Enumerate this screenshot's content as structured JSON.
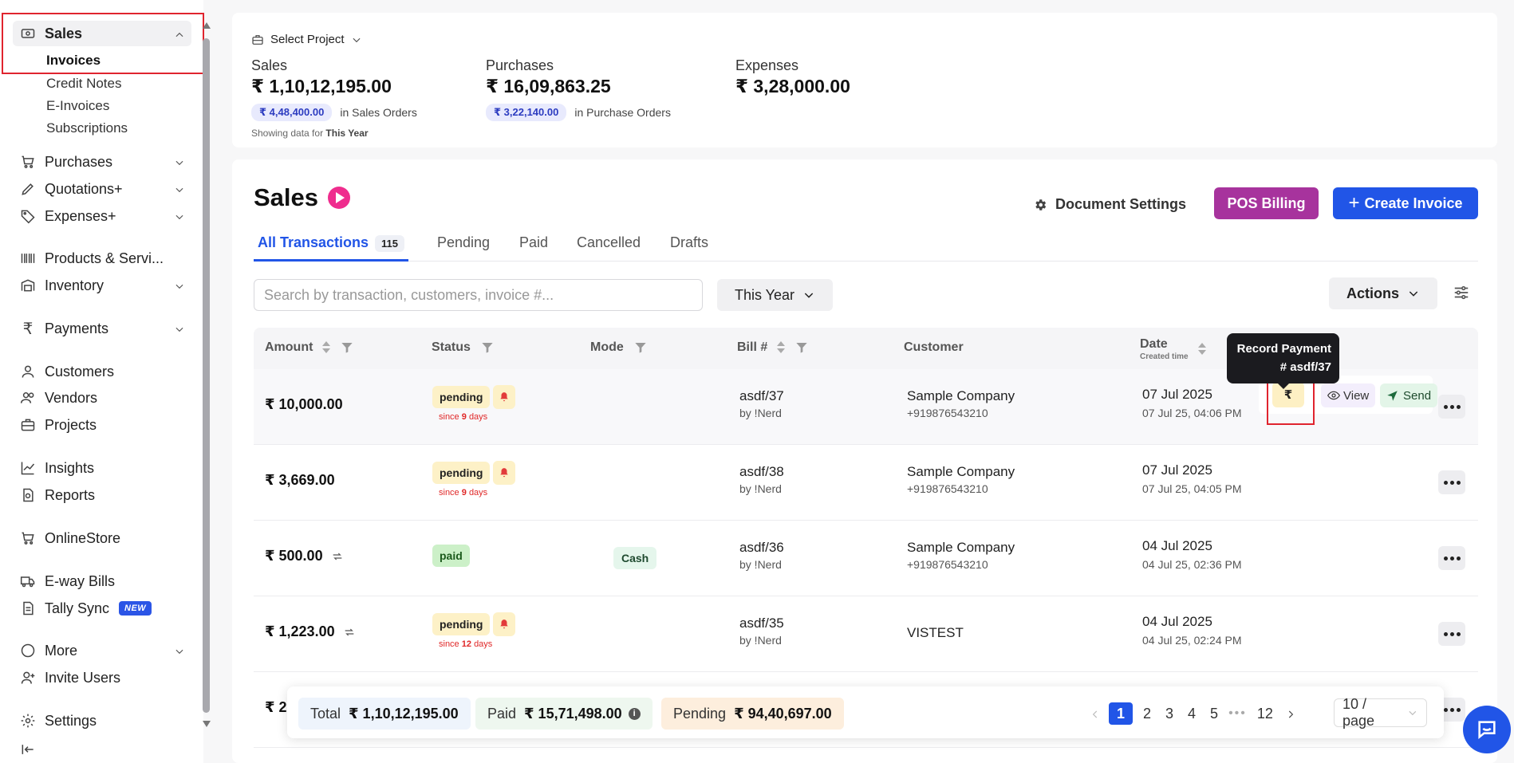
{
  "sidebar": {
    "sales": {
      "label": "Sales",
      "subs": [
        "Invoices",
        "Credit Notes",
        "E-Invoices",
        "Subscriptions"
      ]
    },
    "items": [
      {
        "label": "Purchases"
      },
      {
        "label": "Quotations+"
      },
      {
        "label": "Expenses+"
      },
      {
        "label": "Products & Servi..."
      },
      {
        "label": "Inventory"
      },
      {
        "label": "Payments"
      },
      {
        "label": "Customers"
      },
      {
        "label": "Vendors"
      },
      {
        "label": "Projects"
      },
      {
        "label": "Insights"
      },
      {
        "label": "Reports"
      },
      {
        "label": "OnlineStore"
      },
      {
        "label": "E-way Bills"
      },
      {
        "label": "Tally Sync"
      },
      {
        "label": "More"
      },
      {
        "label": "Invite Users"
      },
      {
        "label": "Settings"
      }
    ],
    "new_badge": "NEW"
  },
  "summary": {
    "select_project": "Select Project",
    "sales": {
      "label": "Sales",
      "value": "₹ 1,10,12,195.00",
      "pill": "₹ 4,48,400.00",
      "pill_note": "in Sales Orders"
    },
    "purchases": {
      "label": "Purchases",
      "value": "₹ 16,09,863.25",
      "pill": "₹ 3,22,140.00",
      "pill_note": "in Purchase Orders"
    },
    "expenses": {
      "label": "Expenses",
      "value": "₹ 3,28,000.00"
    },
    "showing_prefix": "Showing data for",
    "showing_period": "This Year"
  },
  "main": {
    "title": "Sales",
    "doc_settings": "Document Settings",
    "pos_billing": "POS Billing",
    "create_invoice": "Create Invoice",
    "tabs": [
      {
        "label": "All Transactions",
        "count": "115"
      },
      {
        "label": "Pending"
      },
      {
        "label": "Paid"
      },
      {
        "label": "Cancelled"
      },
      {
        "label": "Drafts"
      }
    ],
    "search_placeholder": "Search by transaction, customers, invoice #...",
    "year_filter": "This Year",
    "actions": "Actions"
  },
  "table": {
    "headers": {
      "amount": "Amount",
      "status": "Status",
      "mode": "Mode",
      "bill": "Bill #",
      "customer": "Customer",
      "date": "Date",
      "date_sub": "Created time"
    },
    "rows": [
      {
        "amount": "₹ 10,000.00",
        "status": "pending",
        "since_prefix": "since",
        "since_n": "9",
        "since_suffix": "days",
        "mode": "",
        "bill": "asdf/37",
        "by": "by !Nerd",
        "customer": "Sample Company",
        "phone": "+919876543210",
        "date": "07 Jul 2025",
        "created": "07 Jul 25, 04:06 PM"
      },
      {
        "amount": "₹ 3,669.00",
        "status": "pending",
        "since_prefix": "since",
        "since_n": "9",
        "since_suffix": "days",
        "mode": "",
        "bill": "asdf/38",
        "by": "by !Nerd",
        "customer": "Sample Company",
        "phone": "+919876543210",
        "date": "07 Jul 2025",
        "created": "07 Jul 25, 04:05 PM"
      },
      {
        "amount": "₹ 500.00",
        "status": "paid",
        "mode": "Cash",
        "bill": "asdf/36",
        "by": "by !Nerd",
        "customer": "Sample Company",
        "phone": "+919876543210",
        "date": "04 Jul 2025",
        "created": "04 Jul 25, 02:36 PM"
      },
      {
        "amount": "₹ 1,223.00",
        "status": "pending",
        "since_prefix": "since",
        "since_n": "12",
        "since_suffix": "days",
        "mode": "",
        "bill": "asdf/35",
        "by": "by !Nerd",
        "customer": "VISTEST",
        "phone": "",
        "date": "04 Jul 2025",
        "created": "04 Jul 25, 02:24 PM"
      },
      {
        "amount": "₹ 2,",
        "status": "",
        "mode": "",
        "bill": "",
        "by": "",
        "customer": "",
        "phone": "",
        "date": "",
        "created": ""
      }
    ],
    "row_actions": {
      "rupee": "₹",
      "view": "View",
      "send": "Send"
    },
    "tooltip": {
      "line1": "Record Payment",
      "line2": "# asdf/37"
    }
  },
  "footer": {
    "total_label": "Total",
    "total_value": "₹ 1,10,12,195.00",
    "paid_label": "Paid",
    "paid_value": "₹ 15,71,498.00",
    "pending_label": "Pending",
    "pending_value": "₹ 94,40,697.00",
    "pages": [
      "1",
      "2",
      "3",
      "4",
      "5",
      "12"
    ],
    "current_page": "1",
    "per_page": "10 / page"
  },
  "colors": {
    "primary": "#2155e7",
    "pos": "#a7339d",
    "highlight": "#e0242e"
  }
}
